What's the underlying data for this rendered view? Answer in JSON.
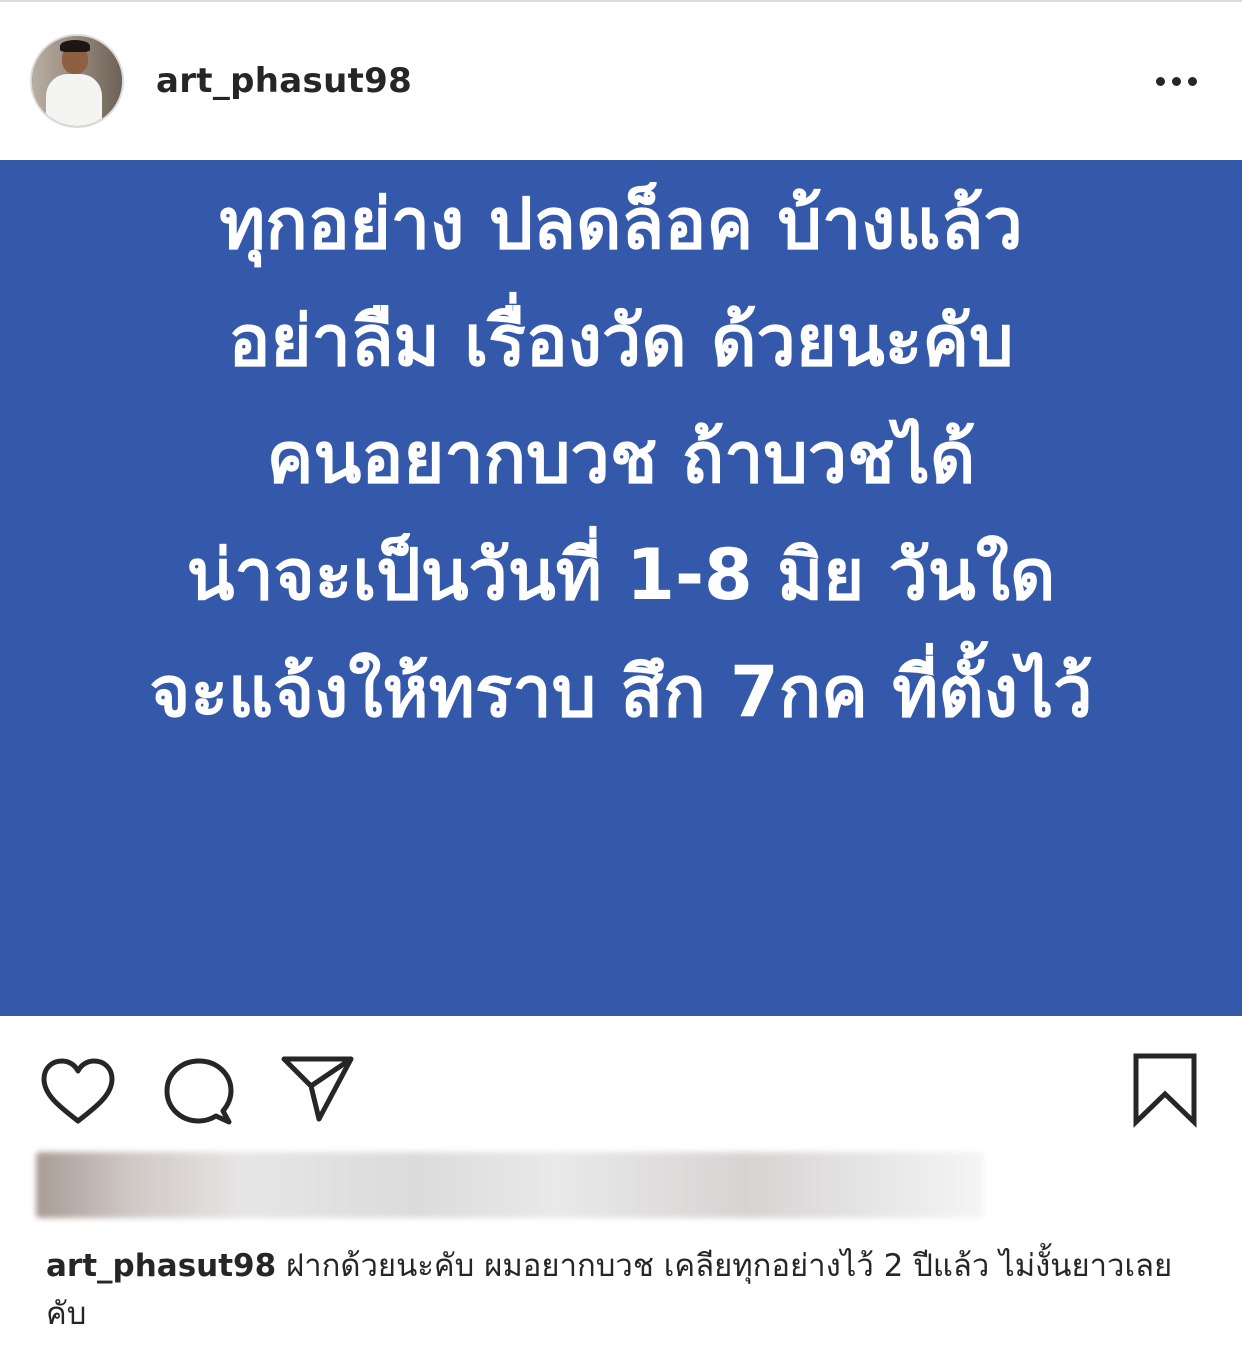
{
  "post": {
    "username": "art_phasut98",
    "more_icon": "more-horizontal-icon",
    "avatar": "profile-avatar"
  },
  "image": {
    "background_color": "#3459ab",
    "text_color": "#ffffff",
    "lines": [
      "ทุกอย่าง ปลดล็อค บ้างแล้ว",
      "อย่าลืม เรื่องวัด ด้วยนะคับ",
      "คนอยากบวช ถ้าบวชได้",
      "น่าจะเป็นวันที่ 1-8 มิย วันใด",
      "จะแจ้งให้ทราบ สึก 7กค ที่ตั้งไว้"
    ]
  },
  "actions": {
    "like_icon": "heart-icon",
    "comment_icon": "comment-bubble-icon",
    "share_icon": "paper-plane-icon",
    "save_icon": "bookmark-icon"
  },
  "caption": {
    "username": "art_phasut98",
    "text": "ฝากด้วยนะคับ ผมอยากบวช เคลียทุกอย่างไว้ 2 ปีแล้ว ไม่งั้นยาวเลยคับ"
  }
}
